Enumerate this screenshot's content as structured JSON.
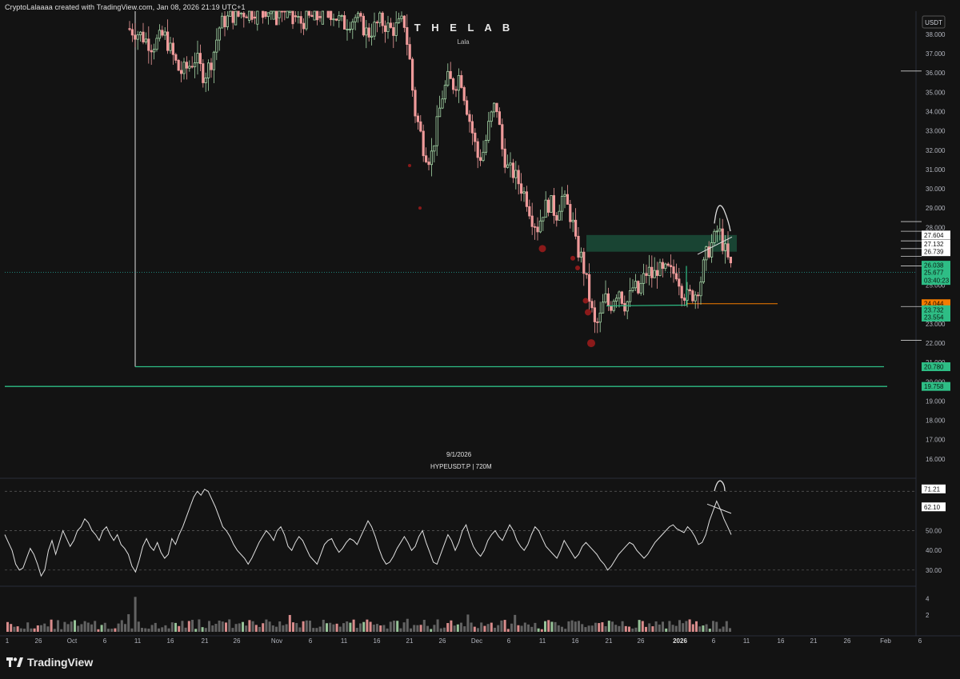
{
  "header": {
    "credit": "CryptoLalaaaa created with TradingView.com, Jan 08, 2026 21:19 UTC+1"
  },
  "watermark": {
    "title": "T H E  L A B",
    "subtitle": "Lala"
  },
  "symbol_info": {
    "date": "9/1/2026",
    "symbol": "HYPEUSDT.P | 720M"
  },
  "currency_badge": "USDT",
  "footer": {
    "brand": "TradingView"
  },
  "colors": {
    "up": "#a5d6a7",
    "down": "#ef9a9a",
    "accent_green": "#26a69a",
    "bright_green": "#2ebd85",
    "orange": "#f57c00",
    "rsi_line": "#e0e0e0",
    "zone_fill": "#1b4d3a",
    "dots": "#7f1d1d"
  },
  "chart_data": {
    "type": "candlestick",
    "y_axis": {
      "ylim": [
        15.0,
        39.2
      ],
      "ticks": [
        "16.000",
        "17.000",
        "18.000",
        "19.000",
        "20.000",
        "21.000",
        "22.000",
        "23.000",
        "24.000",
        "25.000",
        "26.000",
        "27.000",
        "28.000",
        "29.000",
        "30.000",
        "31.000",
        "32.000",
        "33.000",
        "34.000",
        "35.000",
        "36.000",
        "37.000",
        "38.000"
      ]
    },
    "price_labels": [
      {
        "value": "27.604",
        "style": "white"
      },
      {
        "value": "27.132",
        "style": "white"
      },
      {
        "value": "26.739",
        "style": "white"
      },
      {
        "value": "26.038",
        "style": "green"
      },
      {
        "value": "25.677",
        "style": "green"
      },
      {
        "value": "03:40:23",
        "style": "green"
      },
      {
        "value": "24.044",
        "style": "orange"
      },
      {
        "value": "23.732",
        "style": "green"
      },
      {
        "value": "23.554",
        "style": "green"
      },
      {
        "value": "20.780",
        "style": "green"
      },
      {
        "value": "19.758",
        "style": "green"
      }
    ],
    "price_label_values": {
      "27.604": 27.604,
      "27.132": 27.132,
      "26.739": 26.739,
      "26.038": 26.038,
      "25.677": 25.677,
      "03:40:23": 25.25,
      "24.044": 24.044,
      "23.732": 23.732,
      "23.554": 23.35,
      "20.780": 20.78,
      "19.758": 19.758
    },
    "x_axis_labels": [
      "1",
      "26",
      "Oct",
      "6",
      "11",
      "16",
      "21",
      "26",
      "Nov",
      "6",
      "11",
      "16",
      "21",
      "26",
      "Dec",
      "6",
      "11",
      "16",
      "21",
      "26",
      "2026",
      "6",
      "11",
      "16",
      "21",
      "26",
      "Feb",
      "6"
    ],
    "rsi": {
      "ylim": [
        23,
        75
      ],
      "ticks": [
        "30.00",
        "40.00",
        "50.00"
      ],
      "labels": [
        {
          "value": "71.21",
          "level": 71.21
        },
        {
          "value": "62.10",
          "level": 62.1
        }
      ],
      "bands": [
        30,
        50,
        70
      ],
      "values": [
        48,
        44,
        40,
        33,
        30,
        31,
        36,
        41,
        38,
        33,
        27,
        30,
        40,
        45,
        38,
        44,
        50,
        46,
        42,
        45,
        50,
        52,
        56,
        54,
        50,
        48,
        45,
        50,
        52,
        48,
        45,
        48,
        43,
        41,
        38,
        32,
        29,
        35,
        42,
        46,
        42,
        40,
        44,
        39,
        36,
        38,
        46,
        43,
        48,
        52,
        57,
        62,
        67,
        70,
        68,
        71,
        70,
        66,
        62,
        57,
        52,
        50,
        47,
        43,
        40,
        38,
        36,
        33,
        36,
        40,
        44,
        47,
        50,
        48,
        45,
        50,
        52,
        48,
        42,
        40,
        44,
        47,
        45,
        41,
        37,
        35,
        33,
        38,
        43,
        45,
        46,
        42,
        39,
        41,
        44,
        46,
        45,
        43,
        47,
        51,
        55,
        52,
        47,
        41,
        36,
        33,
        34,
        37,
        41,
        44,
        47,
        44,
        40,
        42,
        47,
        50,
        44,
        39,
        34,
        33,
        38,
        43,
        48,
        45,
        40,
        44,
        50,
        53,
        47,
        42,
        39,
        37,
        40,
        45,
        48,
        50,
        47,
        45,
        49,
        53,
        50,
        45,
        42,
        40,
        43,
        48,
        52,
        50,
        46,
        42,
        40,
        38,
        36,
        40,
        45,
        42,
        39,
        36,
        38,
        42,
        44,
        42,
        40,
        38,
        35,
        33,
        30,
        32,
        35,
        38,
        40,
        42,
        44,
        43,
        40,
        38,
        36,
        38,
        41,
        44,
        46,
        48,
        50,
        52,
        53,
        51,
        50,
        49,
        52,
        50,
        47,
        43,
        44,
        48,
        55,
        60,
        65,
        61,
        56,
        52,
        48
      ],
      "trendline_points": [
        [
          884,
          63.5
        ],
        [
          914,
          58.8
        ]
      ],
      "arc_label": "peak"
    },
    "volume": {
      "ticks": [
        "2",
        "4"
      ],
      "ylim": [
        0,
        5
      ]
    },
    "zone": {
      "top": 27.604,
      "bottom": 26.739
    },
    "support_lines": [
      {
        "value": 20.78,
        "label": "20.780"
      },
      {
        "value": 19.758,
        "label": "19.758"
      }
    ],
    "orange_line": 24.044,
    "current_price": 25.677
  }
}
